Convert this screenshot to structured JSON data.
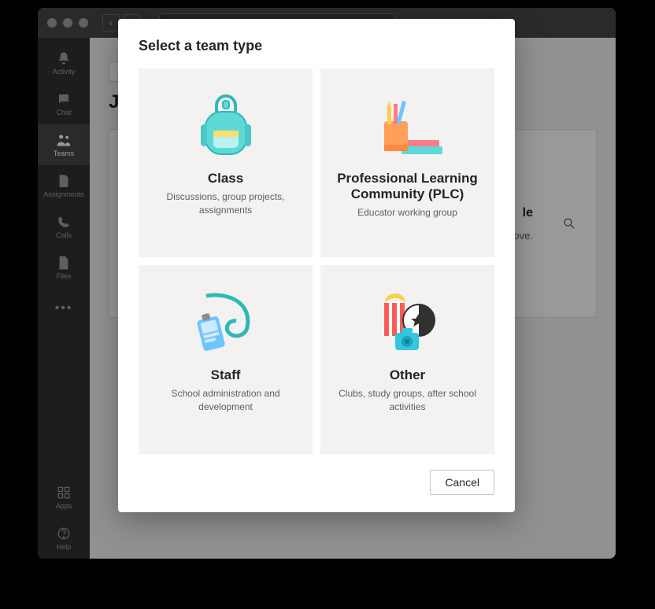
{
  "sidebar": {
    "items": [
      {
        "label": "Activity"
      },
      {
        "label": "Chat"
      },
      {
        "label": "Teams"
      },
      {
        "label": "Assignments"
      },
      {
        "label": "Calls"
      },
      {
        "label": "Files"
      }
    ],
    "apps_label": "Apps",
    "help_label": "Help"
  },
  "page": {
    "title_visible": "Jo",
    "panel_stub_right": "le",
    "panel_stub_text": "ove."
  },
  "modal": {
    "title": "Select a team type",
    "cards": [
      {
        "title": "Class",
        "desc": "Discussions, group projects, assignments"
      },
      {
        "title": "Professional Learning Community (PLC)",
        "desc": "Educator working group"
      },
      {
        "title": "Staff",
        "desc": "School administration and development"
      },
      {
        "title": "Other",
        "desc": "Clubs, study groups, after school activities"
      }
    ],
    "cancel_label": "Cancel"
  }
}
